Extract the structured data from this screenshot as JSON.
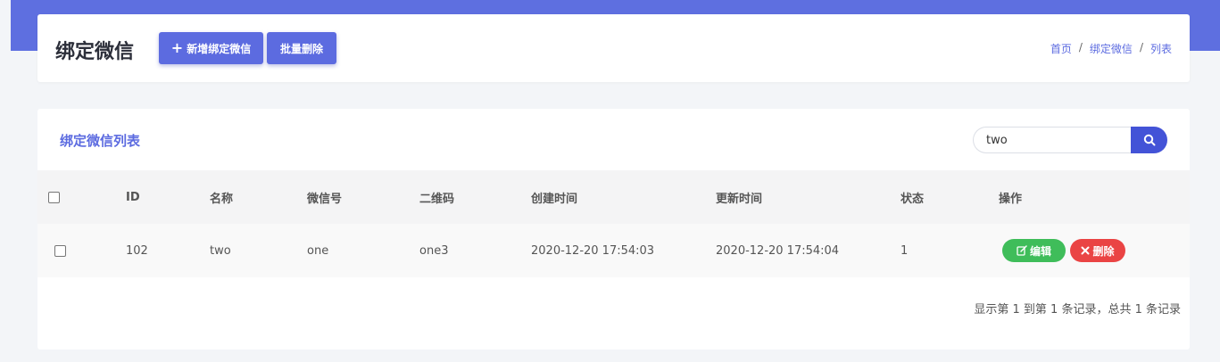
{
  "header": {
    "title": "绑定微信",
    "add_button": "新增绑定微信",
    "batch_delete_button": "批量删除",
    "breadcrumb": [
      "首页",
      "绑定微信",
      "列表"
    ]
  },
  "card": {
    "title": "绑定微信列表",
    "search": {
      "value": "two",
      "placeholder": ""
    }
  },
  "table": {
    "columns": [
      "ID",
      "名称",
      "微信号",
      "二维码",
      "创建时间",
      "更新时间",
      "状态",
      "操作"
    ],
    "rows": [
      {
        "id": "102",
        "name": "two",
        "wechat": "one",
        "qrcode": "one3",
        "created": "2020-12-20 17:54:03",
        "updated": "2020-12-20 17:54:04",
        "status": "1",
        "edit_label": "编辑",
        "delete_label": "删除"
      }
    ]
  },
  "footer": {
    "info": "显示第 1 到第 1 条记录，总共 1 条记录"
  },
  "colors": {
    "accent": "#5c6be0",
    "topband": "#5e6fe0",
    "edit": "#3fbd5a",
    "delete": "#ea4444",
    "search_button": "#4353d7"
  },
  "icons": {
    "add": "plus-icon",
    "search": "search-icon",
    "edit": "edit-icon",
    "delete": "close-icon"
  }
}
